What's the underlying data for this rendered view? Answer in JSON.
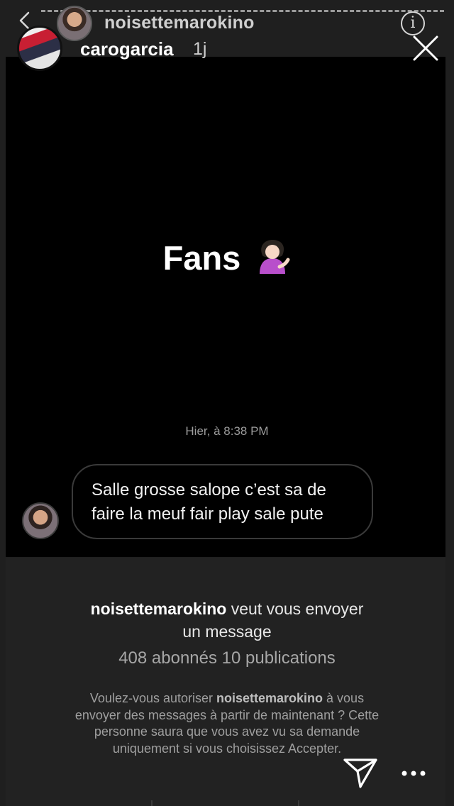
{
  "outer_story": {
    "username": "carogarcia",
    "time_ago": "1j"
  },
  "reposted_story": {
    "username": "noisettemarokino",
    "caption_text": "Fans",
    "caption_emoji": "woman-tipping-hand"
  },
  "dm": {
    "timestamp": "Hier, à 8:38 PM",
    "message_line1": "Salle grosse salope c’est sa de",
    "message_line2": "faire la meuf fair play sale pute"
  },
  "request": {
    "sender": "noisettemarokino",
    "title_suffix": " veut vous envoyer",
    "title_line2": "un message",
    "stats": "408 abonnés 10 publications",
    "body_line1_prefix": "Voulez-vous autoriser ",
    "body_line1_name": "noisettemarokino",
    "body_line1_suffix": " à vous",
    "body_line2": "envoyer des messages à partir de maintenant ? Cette",
    "body_line3": "personne saura que vous avez vu sa demande",
    "body_line4": "uniquement si vous choisissez Accepter."
  },
  "icons": {
    "back": "chevron-left-icon",
    "info": "info-icon",
    "close": "close-icon",
    "send": "send-icon",
    "more": "more-icon"
  },
  "colors": {
    "background": "#000000",
    "panel": "#222222",
    "frame": "#1f1f1f",
    "bubble_border": "#3a3a3a"
  }
}
